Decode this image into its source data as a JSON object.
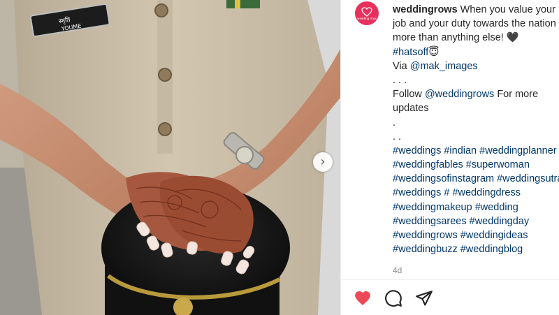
{
  "post": {
    "image_alt": "Hands with henna mehndi resting on a uniform cap",
    "name_plate": {
      "line1": "स्मृति",
      "line2": "YOUME"
    },
    "next_button_glyph": "›"
  },
  "account": {
    "username": "weddingrows",
    "avatar_text": "wedding rows"
  },
  "caption": {
    "line1_text": " When you value your",
    "line2": "job and your duty towards the nation",
    "line3": "more than anything else! 🖤",
    "line4_tag": "#hatsoff",
    "line4_emoji": "😇",
    "line5_prefix": "Via ",
    "line5_mention": "@mak_images",
    "line6": ". . .",
    "line7_prefix": "Follow ",
    "line7_mention": "@weddingrows",
    "line7_suffix": " For more",
    "line8": "updates",
    "line9": ".",
    "line10": ". .",
    "hashtag_lines": [
      "#weddings #indian #weddingplanner",
      "#weddingfables #superwoman",
      "#weddingsofinstagram #weddingsutra",
      "#weddings # #weddingdress",
      "#weddingmakeup #wedding",
      "#weddingsarees #weddingday",
      "#weddingrows #weddingideas",
      "#weddingbuzz #weddingblog"
    ]
  },
  "timestamp": "4d",
  "actions": {
    "like_icon": "heart-filled",
    "comment_icon": "speech-bubble",
    "share_icon": "paper-plane"
  },
  "colors": {
    "like_red": "#ed4956",
    "hashtag_blue": "#00376b",
    "avatar_pink": "#e6315c"
  }
}
